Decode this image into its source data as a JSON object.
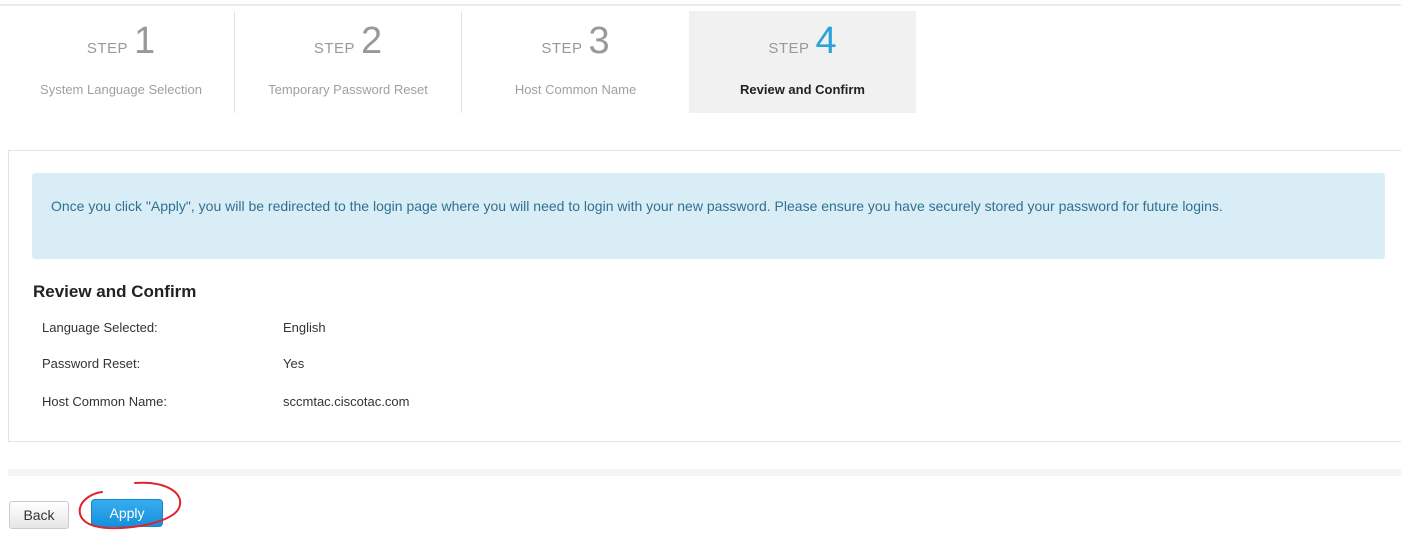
{
  "wizard": {
    "steps": [
      {
        "word": "STEP",
        "number": "1",
        "label": "System Language Selection"
      },
      {
        "word": "STEP",
        "number": "2",
        "label": "Temporary Password Reset"
      },
      {
        "word": "STEP",
        "number": "3",
        "label": "Host Common Name"
      },
      {
        "word": "STEP",
        "number": "4",
        "label": "Review and Confirm"
      }
    ],
    "active_step": 4
  },
  "notice": {
    "text": "Once you click \"Apply\", you will be redirected to the login page where you will need to login with your new password. Please ensure you have securely stored your password for future logins."
  },
  "review": {
    "title": "Review and Confirm",
    "rows": [
      {
        "label": "Language Selected:",
        "value": "English"
      },
      {
        "label": "Password Reset:",
        "value": "Yes"
      },
      {
        "label": "Host Common Name:",
        "value": "sccmtac.ciscotac.com"
      }
    ]
  },
  "actions": {
    "back_label": "Back",
    "apply_label": "Apply"
  },
  "colors": {
    "accent": "#2aa3db",
    "apply_button": "#1a93e0",
    "notice_background": "#d9edf7",
    "annotation": "#e0242b"
  }
}
